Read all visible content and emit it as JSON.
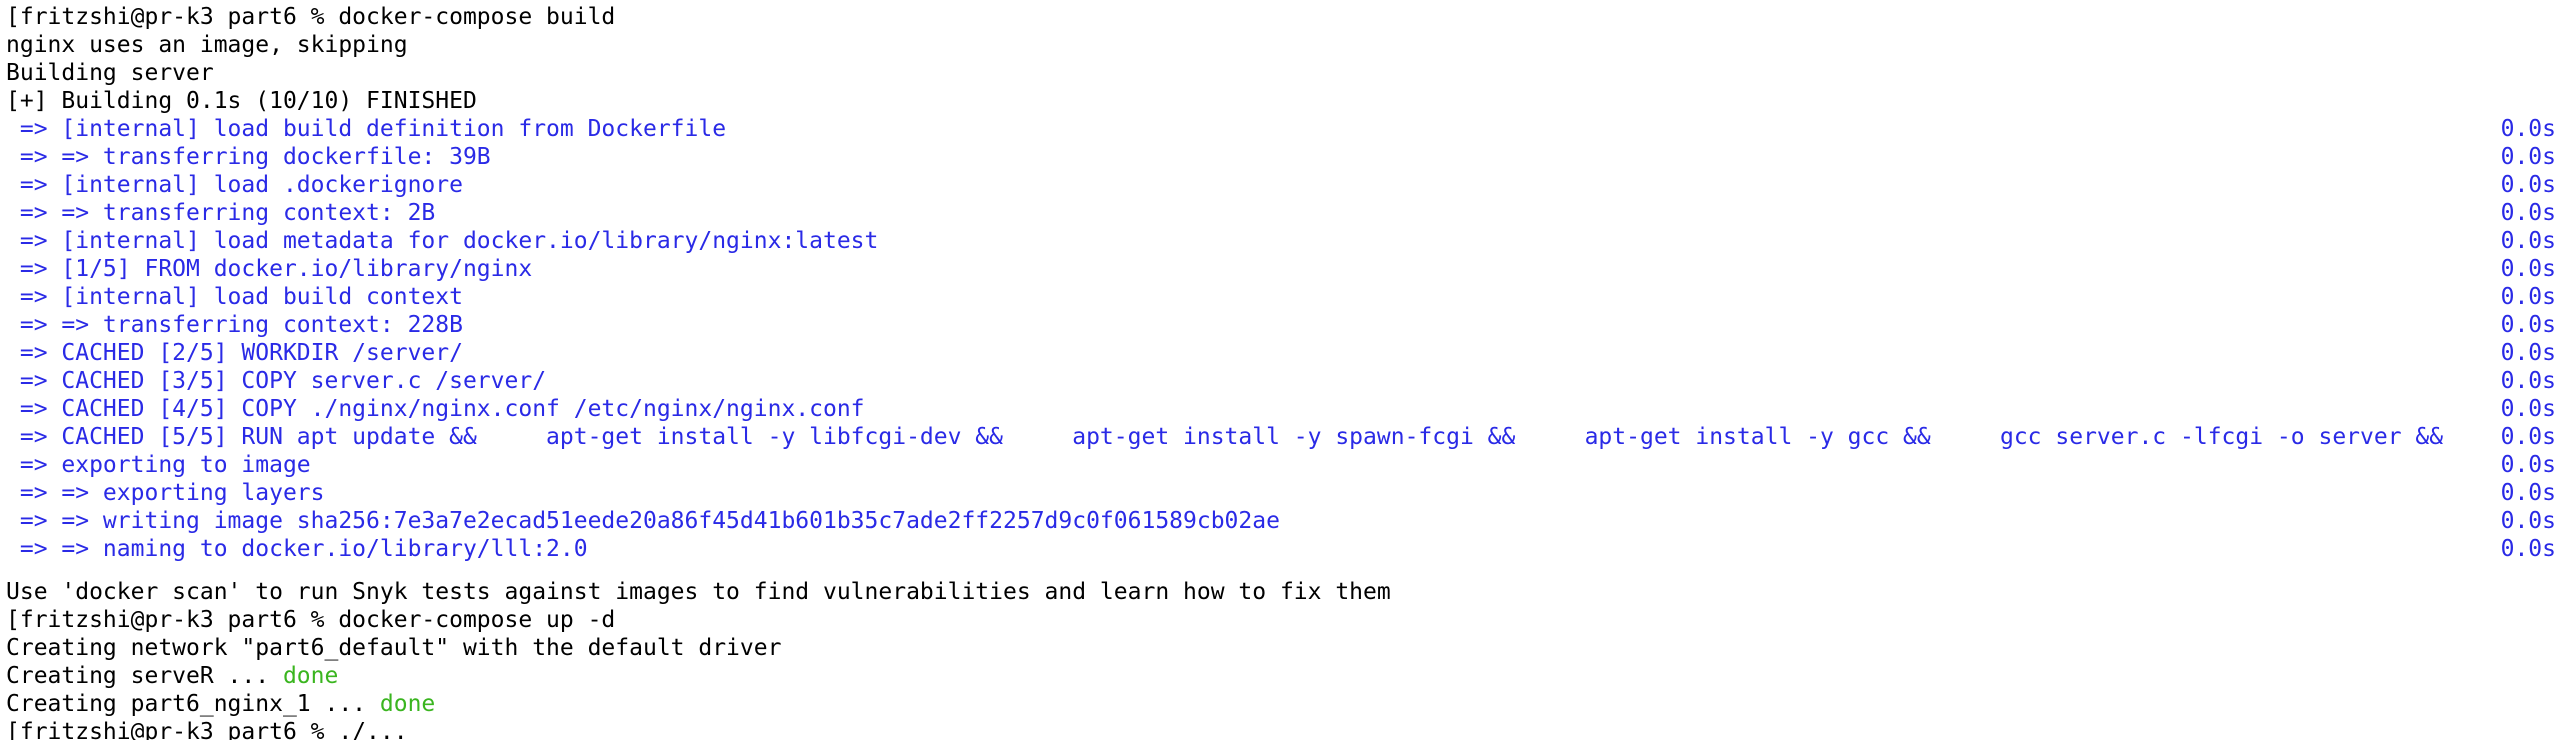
{
  "terminal": {
    "prompt_1": "[fritzshi@pr-k3 part6 % docker-compose build",
    "out_nginx_skip": "nginx uses an image, skipping",
    "out_building_server": "Building server",
    "out_building_status": "[+] Building 0.1s (10/10) FINISHED",
    "build_steps": [
      {
        "text": " => [internal] load build definition from Dockerfile",
        "time": "0.0s"
      },
      {
        "text": " => => transferring dockerfile: 39B",
        "time": "0.0s"
      },
      {
        "text": " => [internal] load .dockerignore",
        "time": "0.0s"
      },
      {
        "text": " => => transferring context: 2B",
        "time": "0.0s"
      },
      {
        "text": " => [internal] load metadata for docker.io/library/nginx:latest",
        "time": "0.0s"
      },
      {
        "text": " => [1/5] FROM docker.io/library/nginx",
        "time": "0.0s"
      },
      {
        "text": " => [internal] load build context",
        "time": "0.0s"
      },
      {
        "text": " => => transferring context: 228B",
        "time": "0.0s"
      },
      {
        "text": " => CACHED [2/5] WORKDIR /server/",
        "time": "0.0s"
      },
      {
        "text": " => CACHED [3/5] COPY server.c /server/",
        "time": "0.0s"
      },
      {
        "text": " => CACHED [4/5] COPY ./nginx/nginx.conf /etc/nginx/nginx.conf",
        "time": "0.0s"
      },
      {
        "text": " => CACHED [5/5] RUN apt update &&     apt-get install -y libfcgi-dev &&     apt-get install -y spawn-fcgi &&     apt-get install -y gcc &&     gcc server.c -lfcgi -o server &&",
        "time": "0.0s"
      },
      {
        "text": " => exporting to image",
        "time": "0.0s"
      },
      {
        "text": " => => exporting layers",
        "time": "0.0s"
      },
      {
        "text": " => => writing image sha256:7e3a7e2ecad51eede20a86f45d41b601b35c7ade2ff2257d9c0f061589cb02ae",
        "time": "0.0s"
      },
      {
        "text": " => => naming to docker.io/library/lll:2.0",
        "time": "0.0s"
      }
    ],
    "out_snyk_hint": "Use 'docker scan' to run Snyk tests against images to find vulnerabilities and learn how to fix them",
    "prompt_2": "[fritzshi@pr-k3 part6 % docker-compose up -d",
    "out_network": "Creating network \"part6_default\" with the default driver",
    "creating_server_prefix": "Creating serveR ... ",
    "creating_server_status": "done",
    "creating_nginx_prefix": "Creating part6_nginx_1 ... ",
    "creating_nginx_status": "done",
    "prompt_3_partial": "[fritzshi@pr-k3 part6 % ./..."
  },
  "colors": {
    "background": "#ffffff",
    "text": "#000000",
    "build_step": "#2a2ae6",
    "done": "#3ab51f"
  }
}
